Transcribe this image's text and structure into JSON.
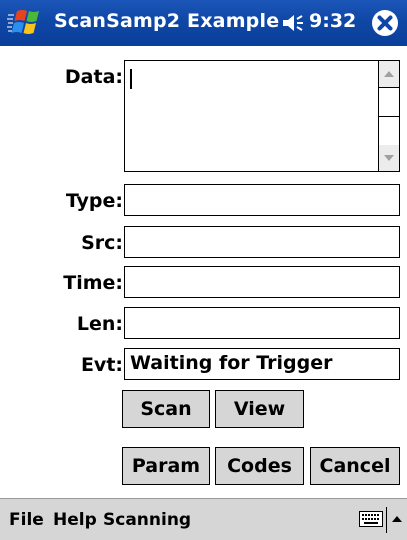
{
  "title_bar": {
    "title": "ScanSamp2 Example",
    "time": "9:32",
    "start_icon": "windows-flag-icon",
    "volume_icon": "speaker-icon",
    "close_icon": "close-icon"
  },
  "form": {
    "data_label": "Data:",
    "data_value": "",
    "type_label": "Type:",
    "type_value": "",
    "src_label": "Src:",
    "src_value": "",
    "time_label": "Time:",
    "time_value": "",
    "len_label": "Len:",
    "len_value": "",
    "evt_label": "Evt:",
    "evt_value": "Waiting for Trigger"
  },
  "buttons": {
    "scan": "Scan",
    "view": "View",
    "param": "Param",
    "codes": "Codes",
    "cancel": "Cancel"
  },
  "menu": {
    "file": "File",
    "help": "Help",
    "scanning": "Scanning",
    "keyboard_icon": "keyboard-icon",
    "sip_arrow_icon": "up-arrow-icon"
  },
  "colors": {
    "title_bar": "#0f47a6",
    "button_face": "#d6d6d6",
    "menu_bar": "#d6d6d6"
  }
}
